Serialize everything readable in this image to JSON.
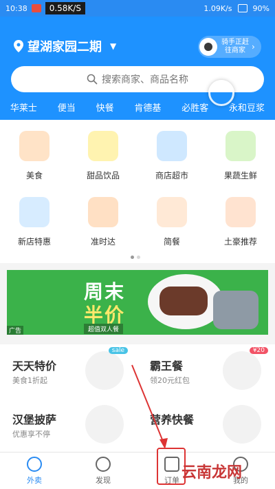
{
  "status_bar": {
    "time": "10:38",
    "speed_box": "0.58K/S",
    "speed_right": "1.09K/s",
    "battery": "90%"
  },
  "header": {
    "location": "望湖家园二期",
    "rider_line1": "骑手正赶",
    "rider_line2": "往商家",
    "search_placeholder": "搜索商家、商品名称",
    "quick_links": [
      "华莱士",
      "便当",
      "快餐",
      "肯德基",
      "必胜客",
      "永和豆浆"
    ]
  },
  "categories": [
    {
      "label": "美食",
      "icon": "food-icon",
      "color": "#ffe3c7"
    },
    {
      "label": "甜品饮品",
      "icon": "drink-icon",
      "color": "#fff3b0"
    },
    {
      "label": "商店超市",
      "icon": "basket-icon",
      "color": "#cfe8ff"
    },
    {
      "label": "果蔬生鲜",
      "icon": "fruit-icon",
      "color": "#d9f5c8"
    },
    {
      "label": "新店特惠",
      "icon": "new-store-icon",
      "color": "#d7ecff"
    },
    {
      "label": "准时达",
      "icon": "ontime-icon",
      "color": "#ffe0c4"
    },
    {
      "label": "简餐",
      "icon": "meal-icon",
      "color": "#ffe9d6"
    },
    {
      "label": "土豪推荐",
      "icon": "chicken-icon",
      "color": "#ffe3d0"
    }
  ],
  "banner": {
    "line1": "周末",
    "line2": "半价",
    "tag": "超值双人餐",
    "ad_label": "广告"
  },
  "promos": [
    {
      "title": "天天特价",
      "subtitle": "美食1折起",
      "badge": "sale"
    },
    {
      "title": "霸王餐",
      "subtitle": "领20元红包",
      "badge": "¥20"
    },
    {
      "title": "汉堡披萨",
      "subtitle": "优惠享不停",
      "badge": ""
    },
    {
      "title": "营养快餐",
      "subtitle": "",
      "badge": ""
    }
  ],
  "tabs": [
    {
      "label": "外卖",
      "active": true
    },
    {
      "label": "发现",
      "active": false
    },
    {
      "label": "订单",
      "active": false
    },
    {
      "label": "我的",
      "active": false
    }
  ],
  "watermark": "云南龙网",
  "colors": {
    "primary": "#1e92ff",
    "banner_green": "#3bb24a",
    "annotation_red": "#d33"
  }
}
